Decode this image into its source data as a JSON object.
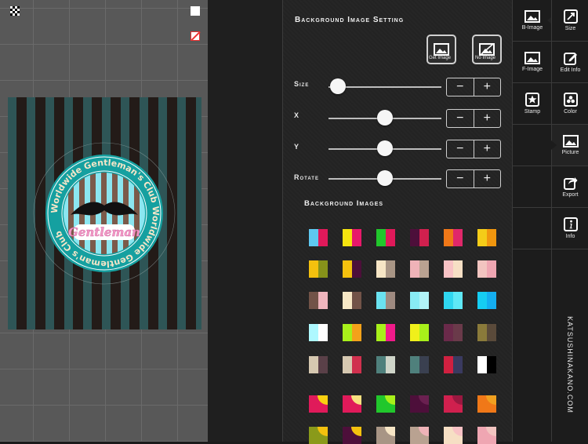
{
  "panel": {
    "title": "Background Image Setting",
    "get_image_label": "Get Image",
    "no_image_label": "No Image",
    "sliders": [
      {
        "label": "Size",
        "value": 0.08
      },
      {
        "label": "X",
        "value": 0.5
      },
      {
        "label": "Y",
        "value": 0.5
      },
      {
        "label": "Rotate",
        "value": 0.5
      }
    ],
    "bg_images_title": "Background Images"
  },
  "tabs": [
    {
      "label": "B-Image",
      "icon": "image-icon",
      "active": true
    },
    {
      "label": "F-Image",
      "icon": "image-icon"
    },
    {
      "label": "Stamp",
      "icon": "star-icon"
    }
  ],
  "sidenav": [
    {
      "label": "Size",
      "icon": "resize-icon"
    },
    {
      "label": "Edit Info",
      "icon": "edit-icon"
    },
    {
      "label": "Color",
      "icon": "color-icon"
    },
    {
      "label": "Picture",
      "icon": "picture-icon",
      "active": true
    },
    {
      "label": "Export",
      "icon": "export-icon"
    },
    {
      "label": "Info",
      "icon": "info-icon"
    }
  ],
  "vertical_text": "KATSUSHINAKANO.COM",
  "badge": {
    "ring_text": "Worldwide Gentleman's Club  Worldwide Gentleman's Club",
    "center_text": "Gentleman"
  },
  "swatches": [
    [
      "#5ec8f0",
      "#e0195a"
    ],
    [
      "#f5e40f",
      "#e8196a"
    ],
    [
      "#21c72c",
      "#e0195a"
    ],
    [
      "#4d0f3a",
      "#d0204e"
    ],
    [
      "#f07818",
      "#e0286a"
    ],
    [
      "#f4cc18",
      "#f0960e"
    ],
    [
      "#f4c10e",
      "#86921a"
    ],
    [
      "#f4c10e",
      "#4d0f3a"
    ],
    [
      "#f6e5c5",
      "#a89585"
    ],
    [
      "#efb3b8",
      "#b9a291"
    ],
    [
      "#f8c2c5",
      "#f6dfc4"
    ],
    [
      "#f2c4c0",
      "#efa6b2"
    ],
    [
      "#725348",
      "#efb5bd"
    ],
    [
      "#f7e8c6",
      "#725348"
    ],
    [
      "#6ae2f0",
      "#9e8a80"
    ],
    [
      "#88ecf4",
      "#b1f4f8"
    ],
    [
      "#2fd7f0",
      "#5fe9f6"
    ],
    [
      "#15cdf2",
      "#14aef0"
    ],
    [
      "#aef8ff",
      "#ffffff"
    ],
    [
      "#a8f01a",
      "#f4a21a"
    ],
    [
      "#a8f01a",
      "#f01a8a"
    ],
    [
      "#f0f01a",
      "#a8f01a"
    ],
    [
      "#6a2a4a",
      "#6a3a4a"
    ],
    [
      "#8a7a3a",
      "#5a4a3a"
    ],
    [
      "#d6c8b0",
      "#5a4048"
    ],
    [
      "#d6c8b0",
      "#d0304e"
    ],
    [
      "#4f807c",
      "#cfd5c9"
    ],
    [
      "#4f807c",
      "#3a4050"
    ],
    [
      "#d02040",
      "#3a3a60"
    ],
    [
      "#ffffff",
      "#000000"
    ],
    [
      "#e01a5a",
      "#f8d010"
    ],
    [
      "#e01a5a",
      "#f8e080"
    ],
    [
      "#21c72c",
      "#a8f01a"
    ],
    [
      "#4d0f3a",
      "#6a2050"
    ],
    [
      "#d0204e",
      "#9a1840"
    ],
    [
      "#f07818",
      "#f0a020"
    ],
    [
      "#8a9a1a",
      "#f4c10e"
    ],
    [
      "#4d0f3a",
      "#f4c10e"
    ],
    [
      "#a89585",
      "#f6e5c5"
    ],
    [
      "#b9a291",
      "#efb3b8"
    ],
    [
      "#f6dfc4",
      "#f8c2c5"
    ],
    [
      "#efa6b2",
      "#f2c4c0"
    ]
  ]
}
